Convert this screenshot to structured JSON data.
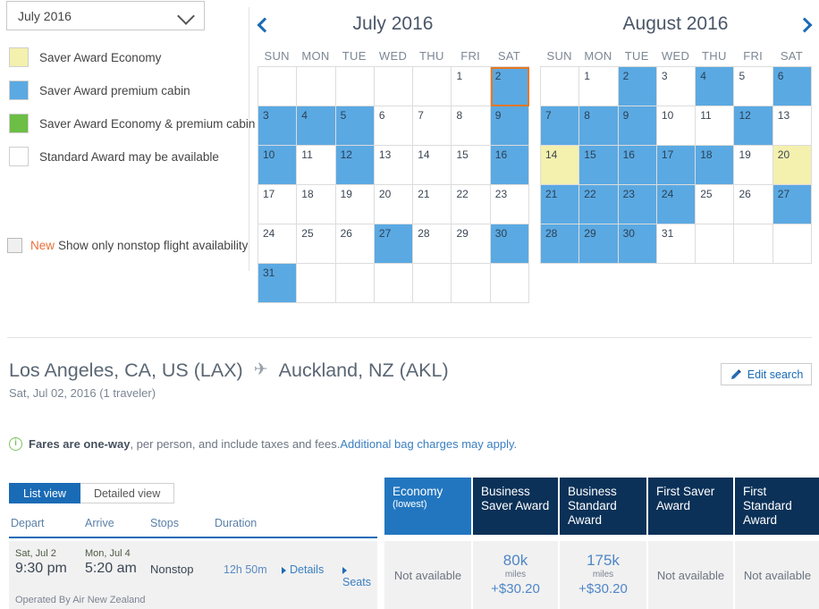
{
  "month_select": {
    "value": "July 2016",
    "icon": "chevron-down-icon"
  },
  "legend": {
    "items": [
      {
        "label": "Saver Award Economy",
        "color": "#f4f0ae"
      },
      {
        "label": "Saver Award premium cabin",
        "color": "#5ba9e2"
      },
      {
        "label": "Saver Award Economy & premium cabin",
        "color": "#6cbe45"
      },
      {
        "label": "Standard Award may be available",
        "color": "#ffffff"
      }
    ],
    "nonstop": {
      "new_badge": "New",
      "label": "Show only nonstop flight availability",
      "checked": false
    }
  },
  "calendars": {
    "prev_icon": "chevron-left-icon",
    "next_icon": "chevron-right-icon",
    "dow": [
      "SUN",
      "MON",
      "TUE",
      "WED",
      "THU",
      "FRI",
      "SAT"
    ],
    "months": [
      {
        "title": "July 2016",
        "lead_blanks": 5,
        "days": [
          {
            "n": 1,
            "state": "none"
          },
          {
            "n": 2,
            "state": "blue",
            "selected": true
          },
          {
            "n": 3,
            "state": "blue"
          },
          {
            "n": 4,
            "state": "blue"
          },
          {
            "n": 5,
            "state": "blue"
          },
          {
            "n": 6,
            "state": "none"
          },
          {
            "n": 7,
            "state": "none"
          },
          {
            "n": 8,
            "state": "none"
          },
          {
            "n": 9,
            "state": "blue"
          },
          {
            "n": 10,
            "state": "blue"
          },
          {
            "n": 11,
            "state": "none"
          },
          {
            "n": 12,
            "state": "blue"
          },
          {
            "n": 13,
            "state": "none"
          },
          {
            "n": 14,
            "state": "none"
          },
          {
            "n": 15,
            "state": "none"
          },
          {
            "n": 16,
            "state": "blue"
          },
          {
            "n": 17,
            "state": "none"
          },
          {
            "n": 18,
            "state": "none"
          },
          {
            "n": 19,
            "state": "none"
          },
          {
            "n": 20,
            "state": "none"
          },
          {
            "n": 21,
            "state": "none"
          },
          {
            "n": 22,
            "state": "none"
          },
          {
            "n": 23,
            "state": "none"
          },
          {
            "n": 24,
            "state": "none"
          },
          {
            "n": 25,
            "state": "none"
          },
          {
            "n": 26,
            "state": "none"
          },
          {
            "n": 27,
            "state": "blue"
          },
          {
            "n": 28,
            "state": "none"
          },
          {
            "n": 29,
            "state": "none"
          },
          {
            "n": 30,
            "state": "blue"
          },
          {
            "n": 31,
            "state": "blue"
          }
        ],
        "trail_blanks": 6
      },
      {
        "title": "August 2016",
        "lead_blanks": 1,
        "days": [
          {
            "n": 1,
            "state": "none"
          },
          {
            "n": 2,
            "state": "blue"
          },
          {
            "n": 3,
            "state": "none"
          },
          {
            "n": 4,
            "state": "blue"
          },
          {
            "n": 5,
            "state": "none"
          },
          {
            "n": 6,
            "state": "blue"
          },
          {
            "n": 7,
            "state": "blue"
          },
          {
            "n": 8,
            "state": "blue"
          },
          {
            "n": 9,
            "state": "blue"
          },
          {
            "n": 10,
            "state": "none"
          },
          {
            "n": 11,
            "state": "none"
          },
          {
            "n": 12,
            "state": "blue"
          },
          {
            "n": 13,
            "state": "none"
          },
          {
            "n": 14,
            "state": "yellow"
          },
          {
            "n": 15,
            "state": "blue"
          },
          {
            "n": 16,
            "state": "blue"
          },
          {
            "n": 17,
            "state": "blue"
          },
          {
            "n": 18,
            "state": "blue"
          },
          {
            "n": 19,
            "state": "none"
          },
          {
            "n": 20,
            "state": "yellow"
          },
          {
            "n": 21,
            "state": "blue"
          },
          {
            "n": 22,
            "state": "blue"
          },
          {
            "n": 23,
            "state": "blue"
          },
          {
            "n": 24,
            "state": "blue"
          },
          {
            "n": 25,
            "state": "none"
          },
          {
            "n": 26,
            "state": "none"
          },
          {
            "n": 27,
            "state": "blue"
          },
          {
            "n": 28,
            "state": "blue"
          },
          {
            "n": 29,
            "state": "blue"
          },
          {
            "n": 30,
            "state": "blue"
          },
          {
            "n": 31,
            "state": "none"
          }
        ],
        "trail_blanks": 3
      }
    ]
  },
  "route": {
    "origin": "Los Angeles, CA, US (LAX)",
    "plane_icon": "airplane-icon",
    "destination": "Auckland, NZ (AKL)",
    "date": "Sat, Jul 02, 2016",
    "travelers": "(1 traveler)",
    "edit_search_label": "Edit search",
    "edit_icon": "pencil-icon"
  },
  "fares_note": {
    "icon": "info-icon",
    "bold": "Fares are one-way",
    "rest": ", per person, and include taxes and fees. ",
    "link": "Additional bag charges may apply."
  },
  "results": {
    "tabs": [
      {
        "label": "List view",
        "active": true
      },
      {
        "label": "Detailed view",
        "active": false
      }
    ],
    "columns": [
      "Depart",
      "Arrive",
      "Stops",
      "Duration"
    ],
    "fare_columns": [
      {
        "title": "Economy",
        "sub": "(lowest)",
        "accent": "#2276bf"
      },
      {
        "title": "Business Saver Award",
        "sub": "",
        "accent": "#0b3158"
      },
      {
        "title": "Business Standard Award",
        "sub": "",
        "accent": "#0b3158"
      },
      {
        "title": "First Saver Award",
        "sub": "",
        "accent": "#0b3158"
      },
      {
        "title": "First Standard Award",
        "sub": "",
        "accent": "#0b3158"
      }
    ],
    "flight": {
      "depart_date": "Sat, Jul 2",
      "depart_time": "9:30 pm",
      "arrive_date": "Mon, Jul 4",
      "arrive_time": "5:20 am",
      "stops": "Nonstop",
      "duration": "12h 50m",
      "details_label": "Details",
      "seats_label": "Seats",
      "operated_by": "Operated By Air New Zealand",
      "fares": [
        {
          "available": false,
          "text": "Not available"
        },
        {
          "available": true,
          "miles": "80k",
          "miles_word": "miles",
          "price": "+$30.20"
        },
        {
          "available": true,
          "miles": "175k",
          "miles_word": "miles",
          "price": "+$30.20"
        },
        {
          "available": false,
          "text": "Not available"
        },
        {
          "available": false,
          "text": "Not available"
        }
      ]
    }
  }
}
